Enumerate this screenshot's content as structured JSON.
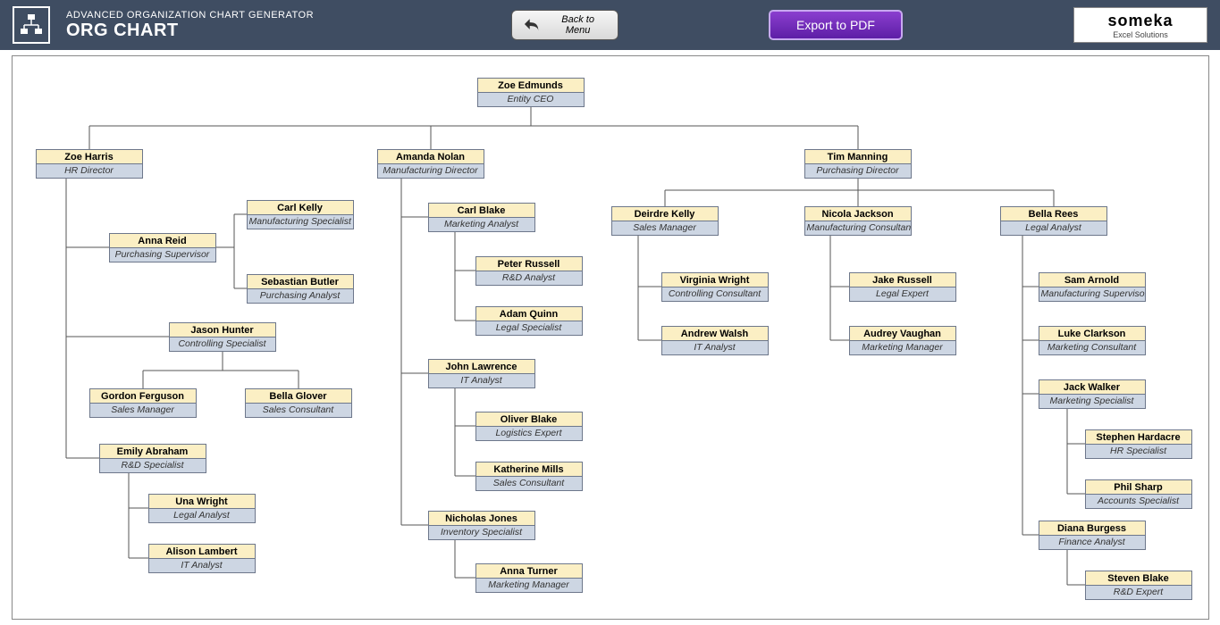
{
  "header": {
    "subtitle": "ADVANCED ORGANIZATION CHART GENERATOR",
    "title": "ORG CHART",
    "back_label": "Back to Menu",
    "export_label": "Export to PDF",
    "brand_top": "someka",
    "brand_bottom": "Excel Solutions"
  },
  "nodes": {
    "ceo": {
      "name": "Zoe Edmunds",
      "role": "Entity CEO"
    },
    "hr_dir": {
      "name": "Zoe Harris",
      "role": "HR Director"
    },
    "mfg_dir": {
      "name": "Amanda Nolan",
      "role": "Manufacturing Director"
    },
    "pur_dir": {
      "name": "Tim Manning",
      "role": "Purchasing Director"
    },
    "anna_reid": {
      "name": "Anna Reid",
      "role": "Purchasing Supervisor"
    },
    "carl_kelly": {
      "name": "Carl Kelly",
      "role": "Manufacturing Specialist"
    },
    "seb_butler": {
      "name": "Sebastian Butler",
      "role": "Purchasing Analyst"
    },
    "jason_hunter": {
      "name": "Jason Hunter",
      "role": "Controlling Specialist"
    },
    "gordon": {
      "name": "Gordon Ferguson",
      "role": "Sales Manager"
    },
    "bella_g": {
      "name": "Bella Glover",
      "role": "Sales Consultant"
    },
    "emily": {
      "name": "Emily Abraham",
      "role": "R&D Specialist"
    },
    "una": {
      "name": "Una Wright",
      "role": "Legal Analyst"
    },
    "alison": {
      "name": "Alison Lambert",
      "role": "IT Analyst"
    },
    "carl_blake": {
      "name": "Carl Blake",
      "role": "Marketing Analyst"
    },
    "peter": {
      "name": "Peter Russell",
      "role": "R&D Analyst"
    },
    "adam": {
      "name": "Adam Quinn",
      "role": "Legal Specialist"
    },
    "john": {
      "name": "John Lawrence",
      "role": "IT Analyst"
    },
    "oliver": {
      "name": "Oliver Blake",
      "role": "Logistics Expert"
    },
    "kath": {
      "name": "Katherine Mills",
      "role": "Sales Consultant"
    },
    "nicholas": {
      "name": "Nicholas Jones",
      "role": "Inventory Specialist"
    },
    "anna_t": {
      "name": "Anna Turner",
      "role": "Marketing Manager"
    },
    "deirdre": {
      "name": "Deirdre Kelly",
      "role": "Sales Manager"
    },
    "virginia": {
      "name": "Virginia Wright",
      "role": "Controlling Consultant"
    },
    "andrew": {
      "name": "Andrew Walsh",
      "role": "IT Analyst"
    },
    "nicola": {
      "name": "Nicola Jackson",
      "role": "Manufacturing Consultant"
    },
    "jake": {
      "name": "Jake Russell",
      "role": "Legal Expert"
    },
    "audrey": {
      "name": "Audrey Vaughan",
      "role": "Marketing Manager"
    },
    "bella_r": {
      "name": "Bella Rees",
      "role": "Legal Analyst"
    },
    "sam": {
      "name": "Sam Arnold",
      "role": "Manufacturing Supervisor"
    },
    "luke": {
      "name": "Luke Clarkson",
      "role": "Marketing Consultant"
    },
    "jack": {
      "name": "Jack Walker",
      "role": "Marketing Specialist"
    },
    "stephen": {
      "name": "Stephen Hardacre",
      "role": "HR Specialist"
    },
    "phil": {
      "name": "Phil Sharp",
      "role": "Accounts Specialist"
    },
    "diana": {
      "name": "Diana Burgess",
      "role": "Finance Analyst"
    },
    "steven_b": {
      "name": "Steven Blake",
      "role": "R&D Expert"
    }
  }
}
